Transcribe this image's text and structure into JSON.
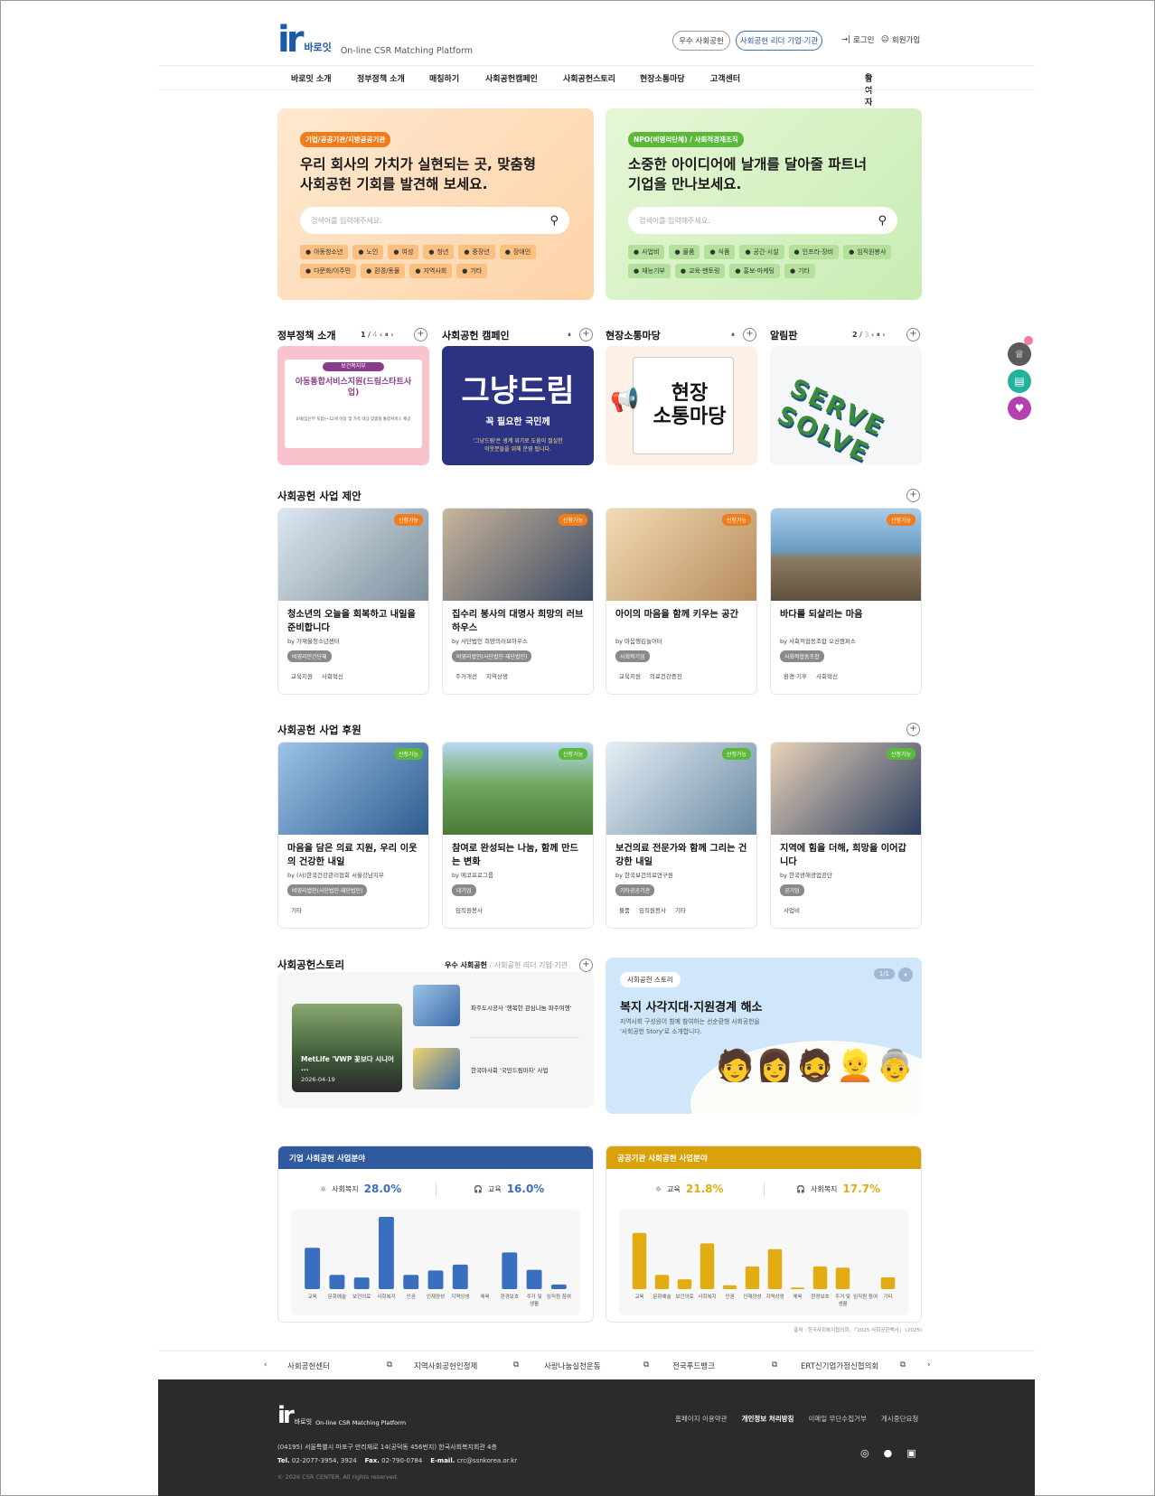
{
  "header": {
    "logo_text": "바로잇",
    "tagline": "On-line CSR Matching Platform",
    "btn_excellent": "우수 사회공헌",
    "btn_leader": "사회공헌 리더 기업·기관",
    "login": "로그인",
    "signup": "회원가입"
  },
  "nav": {
    "items": [
      "바로잇 소개",
      "정부정책 소개",
      "매칭하기",
      "사회공헌캠페인",
      "사회공헌스토리",
      "현장소통마당",
      "고객센터"
    ],
    "participant": "참여자 이야기"
  },
  "banners": [
    {
      "tag": "기업/공공기관/지방공공기관",
      "title1": "우리 회사의 가치가 실현되는 곳, 맞춤형",
      "title2": "사회공헌 기회를 발견해 보세요.",
      "placeholder": "검색어를 입력해주세요.",
      "chips": [
        "아동청소년",
        "노인",
        "여성",
        "청년",
        "중장년",
        "장애인",
        "다문화/이주민",
        "환경/동물",
        "지역사회",
        "기타"
      ]
    },
    {
      "tag": "NPO(비영리단체) / 사회적경제조직",
      "title1": "소중한 아이디어에 날개를 달아줄 파트너",
      "title2": "기업을 만나보세요.",
      "placeholder": "검색어를 입력해주세요.",
      "chips": [
        "사업비",
        "물품",
        "식품",
        "공간·시설",
        "인프라·장비",
        "임직원봉사",
        "재능기부",
        "교육·멘토링",
        "홍보·마케팅",
        "기타"
      ]
    }
  ],
  "tiles": [
    {
      "title": "정부정책 소개",
      "page": "1",
      "total": "4",
      "content_top": "보건복지부",
      "content_title": "아동통합서비스지원(드림스타트사업)",
      "content_body": "0세(임신부 포함)~12세 아동 및 가족 대상 맞춤형 통합서비스 제공"
    },
    {
      "title": "사회공헌 캠페인",
      "content_title": "그냥드림",
      "content_sub": "꼭 필요한 국민께",
      "content_body1": "'그냥드림'은 생계 위기로 도움이 절실한",
      "content_body2": "이웃분들을 위해 운영 됩니다."
    },
    {
      "title": "현장소통마당",
      "content_title1": "현장",
      "content_title2": "소통마당"
    },
    {
      "title": "알림판",
      "page": "2",
      "total": "3",
      "content_title": "SERVE SOLVE"
    }
  ],
  "proposals": {
    "title": "사회공헌 사업 제안",
    "cards": [
      {
        "badge": "신청가능",
        "title": "청소년의 오늘을 회복하고 내일을 준비합니다",
        "by": "by 가재울청소년센터",
        "org": "비영리민간단체",
        "kw": [
          "교육지원",
          "사회혁신"
        ]
      },
      {
        "badge": "신청가능",
        "title": "집수리 봉사의 대명사 희망의 러브하우스",
        "by": "by 사단법인 희망의러브하우스",
        "org": "비영리법인(사단법인·재단법인)",
        "kw": [
          "주거개선",
          "지역상생"
        ]
      },
      {
        "badge": "신청가능",
        "title": "아이의 마음을 함께 키우는 공간",
        "by": "by 마음행김놀이터",
        "org": "사회적기업",
        "kw": [
          "교육지원",
          "의료건강증진"
        ]
      },
      {
        "badge": "신청가능",
        "title": "바다를 되살리는 마음",
        "by": "by 사회적협동조합 오션캠퍼스",
        "org": "사회적협동조합",
        "kw": [
          "환경·기후",
          "사회혁신"
        ]
      }
    ]
  },
  "sponsors": {
    "title": "사회공헌 사업 후원",
    "cards": [
      {
        "badge": "신청가능",
        "title": "마음을 담은 의료 지원, 우리 이웃의 건강한 내일",
        "by": "by (사)한국건강관리협회 서울강남지부",
        "org": "비영리법인(사단법인·재단법인)",
        "kw": [
          "기타"
        ]
      },
      {
        "badge": "신청가능",
        "title": "참여로 완성되는 나눔, 함께 만드는 변화",
        "by": "by 에코프로그룹",
        "org": "대기업",
        "kw": [
          "임직원봉사"
        ]
      },
      {
        "badge": "신청가능",
        "title": "보건의료 전문가와 함께 그리는 건강한 내일",
        "by": "by 한국보건의료연구원",
        "org": "기타공공기관",
        "kw": [
          "물품",
          "임직원봉사",
          "기타"
        ]
      },
      {
        "badge": "신청가능",
        "title": "지역에 힘을 더해, 희망을 이어갑니다",
        "by": "by 한국광해광업공단",
        "org": "공기업",
        "kw": [
          "사업비"
        ]
      }
    ]
  },
  "story": {
    "title": "사회공헌스토리",
    "tab_active": "우수 사회공헌",
    "tab_inactive": "사회공헌 리더 기업·기관",
    "main_caption": "MetLife 'VWP 꽃보다 시니어 ...",
    "main_date": "2026-04-19",
    "list": [
      "파주도시공사 '행복한 관심나눔 파주여행'",
      "한국마사회 '국민드림마차' 사업"
    ],
    "banner_tag": "사회공헌 스토리",
    "banner_page": "1/1",
    "banner_title": "복지 사각지대·지원경계 해소",
    "banner_desc1": "지역사회 구성원이 함께 참여하는 선순환형 사회공헌을",
    "banner_desc2": "'사회공헌 Story'로 소개합니다."
  },
  "charts": {
    "source": "출처 : 한국사회복지협의회, 「2025 사회공헌백서」 (2025)",
    "corporate": {
      "title": "기업 사회공헌 사업분야",
      "stat1_label": "사회복지",
      "stat1_value": "28.0%",
      "stat2_label": "교육",
      "stat2_value": "16.0%",
      "color": "#3a6fbf",
      "header_color": "#2f5aa0"
    },
    "public": {
      "title": "공공기관 사회공헌 사업분야",
      "stat1_label": "교육",
      "stat1_value": "21.8%",
      "stat2_label": "사회복지",
      "stat2_value": "17.7%",
      "color": "#e2ad12",
      "header_color": "#d9a20b"
    }
  },
  "chart_data": [
    {
      "type": "bar",
      "title": "기업 사회공헌 사업분야",
      "categories": [
        "교육",
        "문화예술",
        "보건의료",
        "사회복지",
        "인권",
        "인재양성",
        "지역상생",
        "체육",
        "환경보호",
        "주거 및 생활",
        "임직원 참여"
      ],
      "values": [
        16.0,
        5.5,
        4.5,
        28.0,
        5.5,
        7.2,
        9.5,
        0,
        14.2,
        7.5,
        1.8
      ]
    },
    {
      "type": "bar",
      "title": "공공기관 사회공헌 사업분야",
      "categories": [
        "교육",
        "문화예술",
        "보건의료",
        "사회복지",
        "인권",
        "인재양성",
        "지역상생",
        "체육",
        "환경보호",
        "주거 및 생활",
        "임직원 참여",
        "기타"
      ],
      "values": [
        21.8,
        5.5,
        3.8,
        17.7,
        1.5,
        8.8,
        15.5,
        0.6,
        8.8,
        8.3,
        0,
        4.6
      ]
    }
  ],
  "bottom_links": [
    "사회공헌센터",
    "지역사회공헌인정제",
    "사랑나눔실천운동",
    "전국푸드뱅크",
    "ERT신기업가정신협의회"
  ],
  "footer": {
    "logo": "바로잇",
    "tagline": "On-line CSR Matching Platform",
    "links": [
      "홈페이지 이용약관",
      "개인정보 처리방침",
      "이메일 무단수집거부",
      "게시중단요청"
    ],
    "address": "(04195) 서울특별시 마포구 만리재로 14(공덕동 456번지) 한국사회복지회관 4층",
    "tel_label": "Tel.",
    "tel": "02-2077-3954, 3924",
    "fax_label": "Fax.",
    "fax": "02-790-0784",
    "email_label": "E-mail.",
    "email": "crc@ssnkorea.or.kr",
    "copyright": "© 2026 CSR CENTER. All rights reserved."
  }
}
